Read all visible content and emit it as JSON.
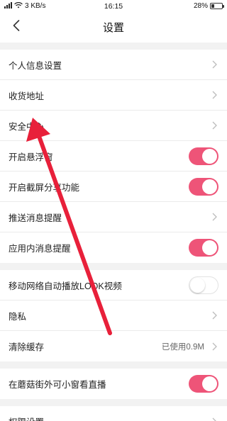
{
  "status_bar": {
    "signal": ".ıll",
    "speed": "3 KB/s",
    "time": "16:15",
    "battery_percent": "28%",
    "battery_level": 0.28
  },
  "header": {
    "title": "设置"
  },
  "settings": {
    "personal_info": "个人信息设置",
    "shipping_address": "收货地址",
    "security_center": "安全中心",
    "floating_window": "开启悬浮窗",
    "screenshot_share": "开启截屏分享功能",
    "push_reminder": "推送消息提醒",
    "in_app_reminder": "应用内消息提醒",
    "mobile_autoplay": "移动网络自动播放LOOK视频",
    "privacy": "隐私",
    "clear_cache": "清除缓存",
    "cache_used": "已使用0.9M",
    "pip_live": "在蘑菇街外可小窗看直播",
    "permissions": "权限设置"
  },
  "toggles": {
    "floating_window": true,
    "screenshot_share": true,
    "in_app_reminder": true,
    "mobile_autoplay": false,
    "pip_live": true
  },
  "colors": {
    "toggle_on": "#ee5478",
    "annotation_arrow": "#e8203a",
    "background": "#f2f2f2"
  },
  "icons": [
    "back-arrow-icon",
    "chevron-right-icon",
    "wifi-icon",
    "battery-icon",
    "signal-icon"
  ]
}
